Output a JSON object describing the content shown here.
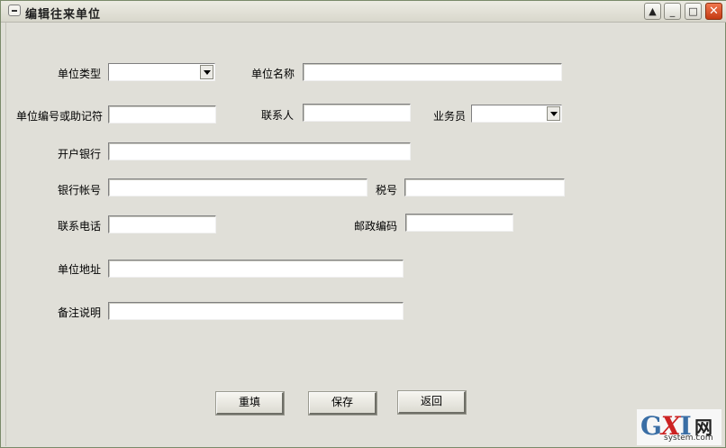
{
  "window": {
    "title": "编辑往来单位",
    "buttons": {
      "up": "▲",
      "minimize": "_",
      "maximize": "□",
      "close": "✕"
    }
  },
  "form": {
    "unit_type": {
      "label": "单位类型",
      "value": ""
    },
    "unit_name": {
      "label": "单位名称",
      "value": ""
    },
    "unit_code": {
      "label": "单位编号或助记符",
      "value": ""
    },
    "contact": {
      "label": "联系人",
      "value": ""
    },
    "salesperson": {
      "label": "业务员",
      "value": ""
    },
    "bank": {
      "label": "开户银行",
      "value": ""
    },
    "bank_account": {
      "label": "银行帐号",
      "value": ""
    },
    "tax_no": {
      "label": "税号",
      "value": ""
    },
    "phone": {
      "label": "联系电话",
      "value": ""
    },
    "postcode": {
      "label": "邮政编码",
      "value": ""
    },
    "address": {
      "label": "单位地址",
      "value": ""
    },
    "remark": {
      "label": "备注说明",
      "value": ""
    }
  },
  "actions": {
    "reset": "重填",
    "save": "保存",
    "back": "返回"
  },
  "watermark": {
    "g": "G",
    "x": "X",
    "i": "I",
    "net": "网",
    "url": "system.com"
  }
}
